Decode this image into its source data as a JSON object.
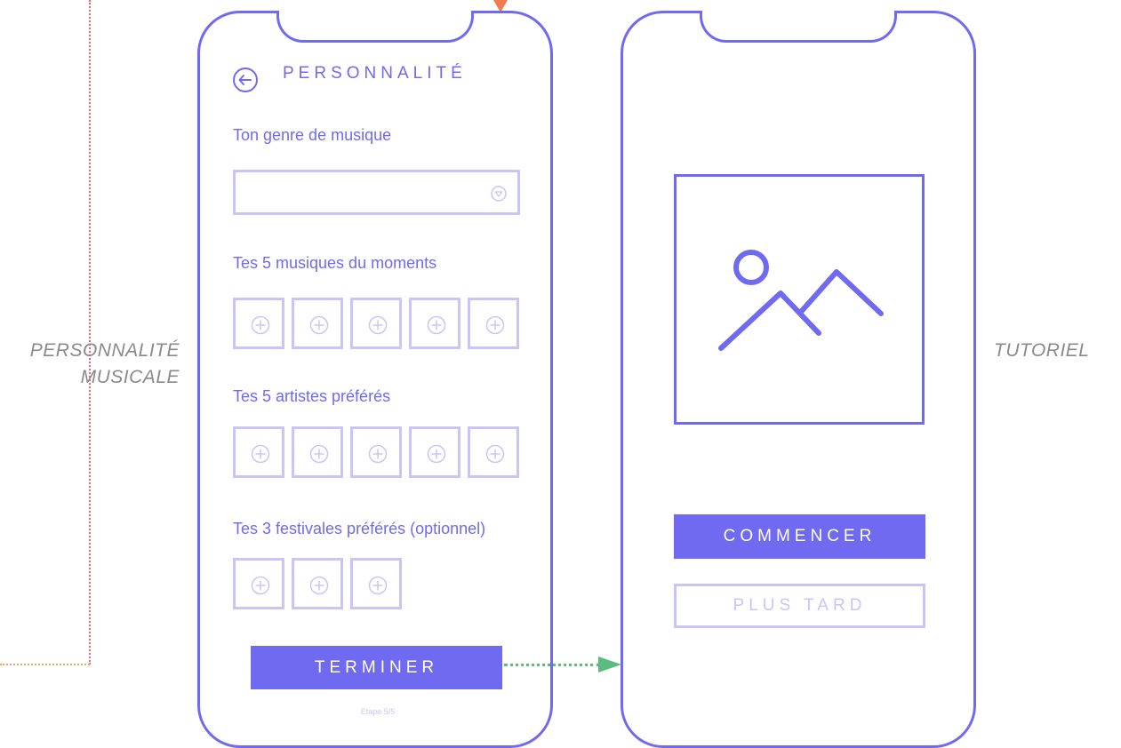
{
  "captions": {
    "left_line1": "PERSONNALITÉ",
    "left_line2": "MUSICALE",
    "right": "TUTORIEL"
  },
  "personality_screen": {
    "title": "PERSONNALITÉ",
    "back_icon": "arrow-left-circle-icon",
    "genre_label": "Ton genre de musique",
    "genre_value": "",
    "dropdown_icon": "triangle-down-circle-icon",
    "musiques_label": "Tes 5 musiques du moments",
    "artistes_label": "Tes 5 artistes préférés",
    "festivals_label": "Tes 3 festivales préférés (optionnel)",
    "add_icon": "plus-circle-icon",
    "finish_button": "TERMINER",
    "step": "Etape 5/5"
  },
  "tutorial_screen": {
    "image_placeholder_icon": "image-placeholder-icon",
    "start_button": "COMMENCER",
    "later_button": "PLUS TARD"
  },
  "colors": {
    "primary": "#6f6af0",
    "light": "#c9c5f7",
    "connector_green": "#59bd7f",
    "connector_red": "#f0646b",
    "caption": "#8a8a8a"
  }
}
